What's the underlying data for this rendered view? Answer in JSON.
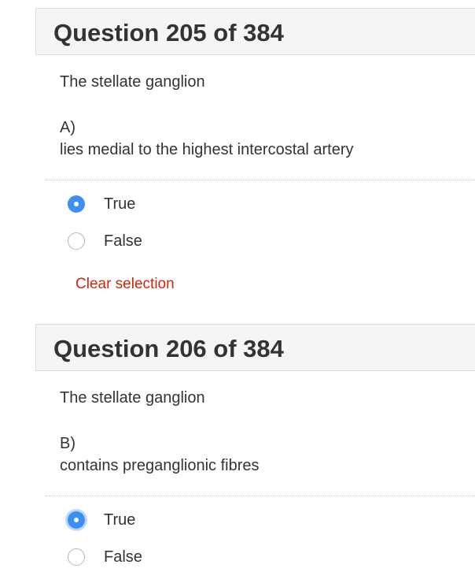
{
  "questions": [
    {
      "title": "Question 205 of 384",
      "stem": "The stellate ganglion",
      "part_label": "A)",
      "part_text": "lies medial to the highest intercostal artery",
      "options": [
        {
          "label": "True",
          "selected": true
        },
        {
          "label": "False",
          "selected": false
        }
      ],
      "clear_label": "Clear selection"
    },
    {
      "title": "Question 206 of 384",
      "stem": "The stellate ganglion",
      "part_label": "B)",
      "part_text": "contains preganglionic fibres",
      "options": [
        {
          "label": "True",
          "selected": true
        },
        {
          "label": "False",
          "selected": false
        }
      ]
    }
  ],
  "colors": {
    "accent": "#3d8ff0",
    "clear_link": "#d0260f",
    "header_bg": "#f5f5f5"
  }
}
